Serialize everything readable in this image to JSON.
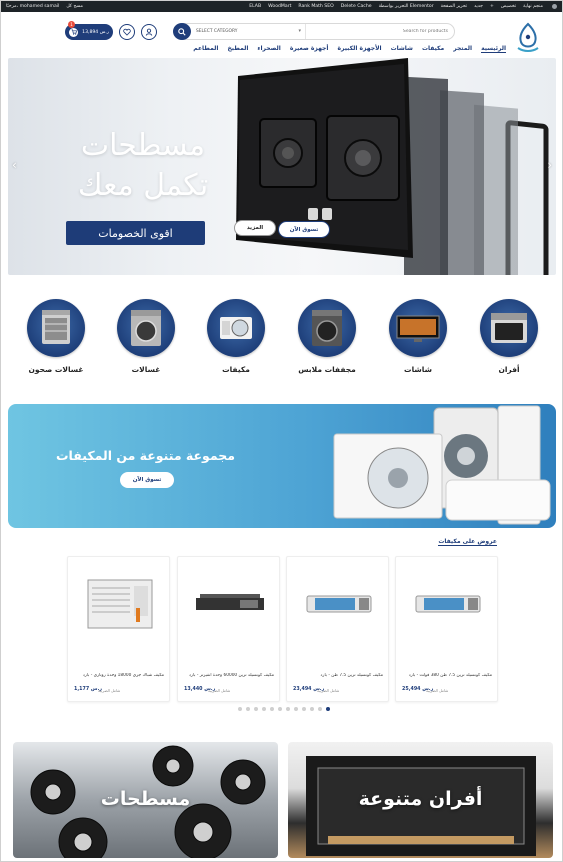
{
  "admin_bar": {
    "left": [
      "مرحبًا، mohamed samail",
      "مسح كل"
    ],
    "right": [
      "منجم نهاية",
      "تخصيص",
      "+",
      "جديد",
      "تحرير الصفحة",
      "التحرير بواسطة Elementor",
      "Delete Cache",
      "Rank Math SEO",
      "WoodMart",
      "ELAB"
    ]
  },
  "header": {
    "search_placeholder": "Search for products",
    "category_label": "SELECT CATEGORY",
    "cart_amount": "13,894 ر.س",
    "cart_count": "1",
    "nav": [
      "الرئيسية",
      "المتجر",
      "مكيفات",
      "شاشات",
      "الأجهزة الكبيرة",
      "أجهزة صغيرة",
      "الصحراء",
      "المطبخ",
      "المطاعم"
    ]
  },
  "hero": {
    "line1": "مسطحات",
    "line2": "تكمل معك",
    "banner": "اقوى الخصومات",
    "more_btn": "المزيد",
    "shop_btn": "تسوق الآن"
  },
  "categories": [
    "أفران",
    "شاشات",
    "مجففات ملابس",
    "مكيفات",
    "غسالات",
    "غسالات صحون"
  ],
  "promo": {
    "title": "مجموعة متنوعة من المكيفات",
    "button": "تسوق الآن"
  },
  "offers_title": "عروض على مكيفات",
  "products": [
    {
      "name": "مكيف كونسيلد ترين 7.5 طن 380 فولت - بارد",
      "price": "25,494 ر.س",
      "tax": "شامل الضريبة"
    },
    {
      "name": "مكيف كونسيلد ترين 7.5 طن - بارد",
      "price": "23,494 ر.س",
      "tax": "شامل الضريبة"
    },
    {
      "name": "مكيف كونسيلد ترين 60000 وحدة انفيرتر - بارد",
      "price": "13,440 ر.س",
      "tax": "شامل الضريبة"
    },
    {
      "name": "مكيف شباك جري 18000 وحدة روتاري - بارد",
      "price": "1,177 ر.س",
      "tax": "شامل الضريبة"
    }
  ],
  "carousel_dots": {
    "count": 12,
    "active_index": 11
  },
  "bottom_cards": [
    "أفران متنوعة",
    "مسطحات"
  ],
  "colors": {
    "brand": "#1f3d7a",
    "promo": "#4da3d4",
    "admin": "#1d2327"
  }
}
